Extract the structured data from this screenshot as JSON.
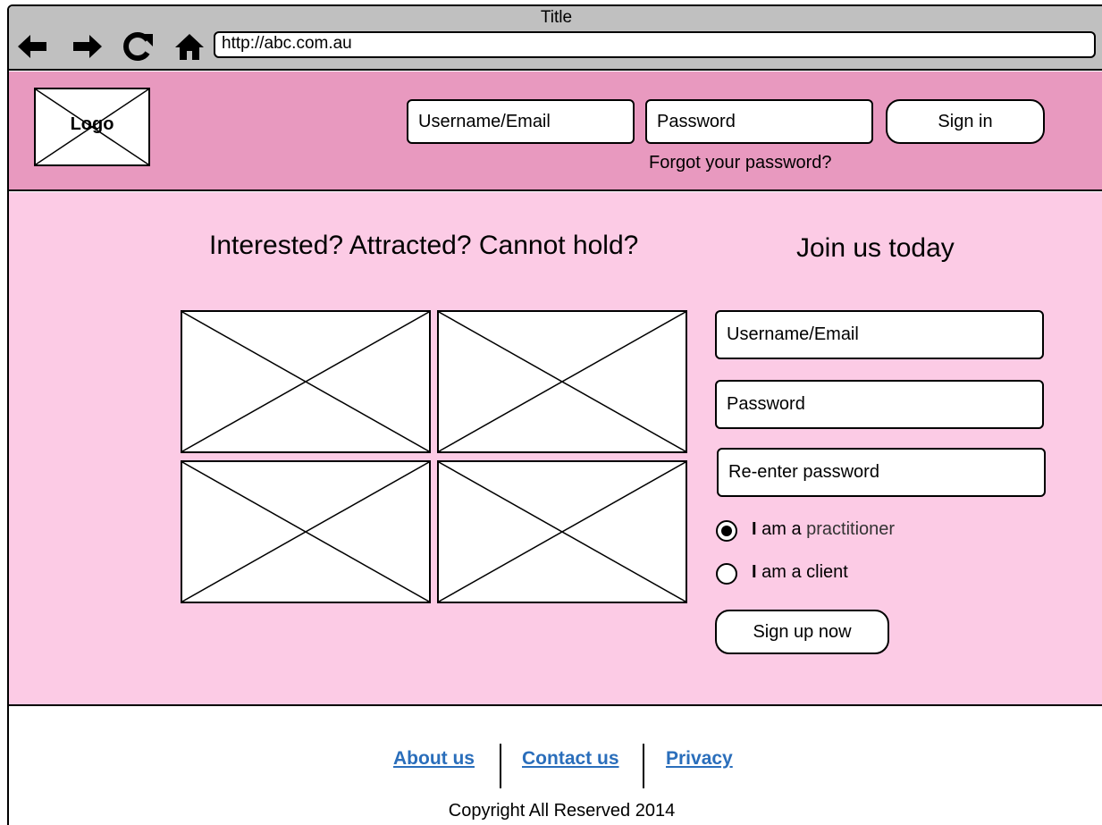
{
  "browser": {
    "title": "Title",
    "url": "http://abc.com.au",
    "nav_icons": [
      "back-arrow-icon",
      "forward-arrow-icon",
      "reload-icon",
      "home-icon"
    ]
  },
  "header": {
    "logo_label": "Logo",
    "username_placeholder": "Username/Email",
    "password_placeholder": "Password",
    "signin_label": "Sign in",
    "forgot_label": "Forgot your password?"
  },
  "main": {
    "headline": "Interested? Attracted? Cannot hold?",
    "join_title": "Join us today",
    "signup": {
      "username_placeholder": "Username/Email",
      "password_placeholder": "Password",
      "reenter_placeholder": "Re-enter password",
      "role_options": [
        {
          "prefix": "I",
          "rest": " am a ",
          "role": "practitioner",
          "selected": true
        },
        {
          "prefix": "I",
          "rest": " am a ",
          "role": "client",
          "selected": false
        }
      ],
      "submit_label": "Sign up now"
    }
  },
  "footer": {
    "links": [
      "About us",
      "Contact us",
      "Privacy"
    ],
    "copyright": "Copyright All Reserved 2014"
  },
  "colors": {
    "chrome": "#c0c0c0",
    "header": "#e899bf",
    "main": "#fccbe5",
    "link": "#2a6ebb"
  }
}
